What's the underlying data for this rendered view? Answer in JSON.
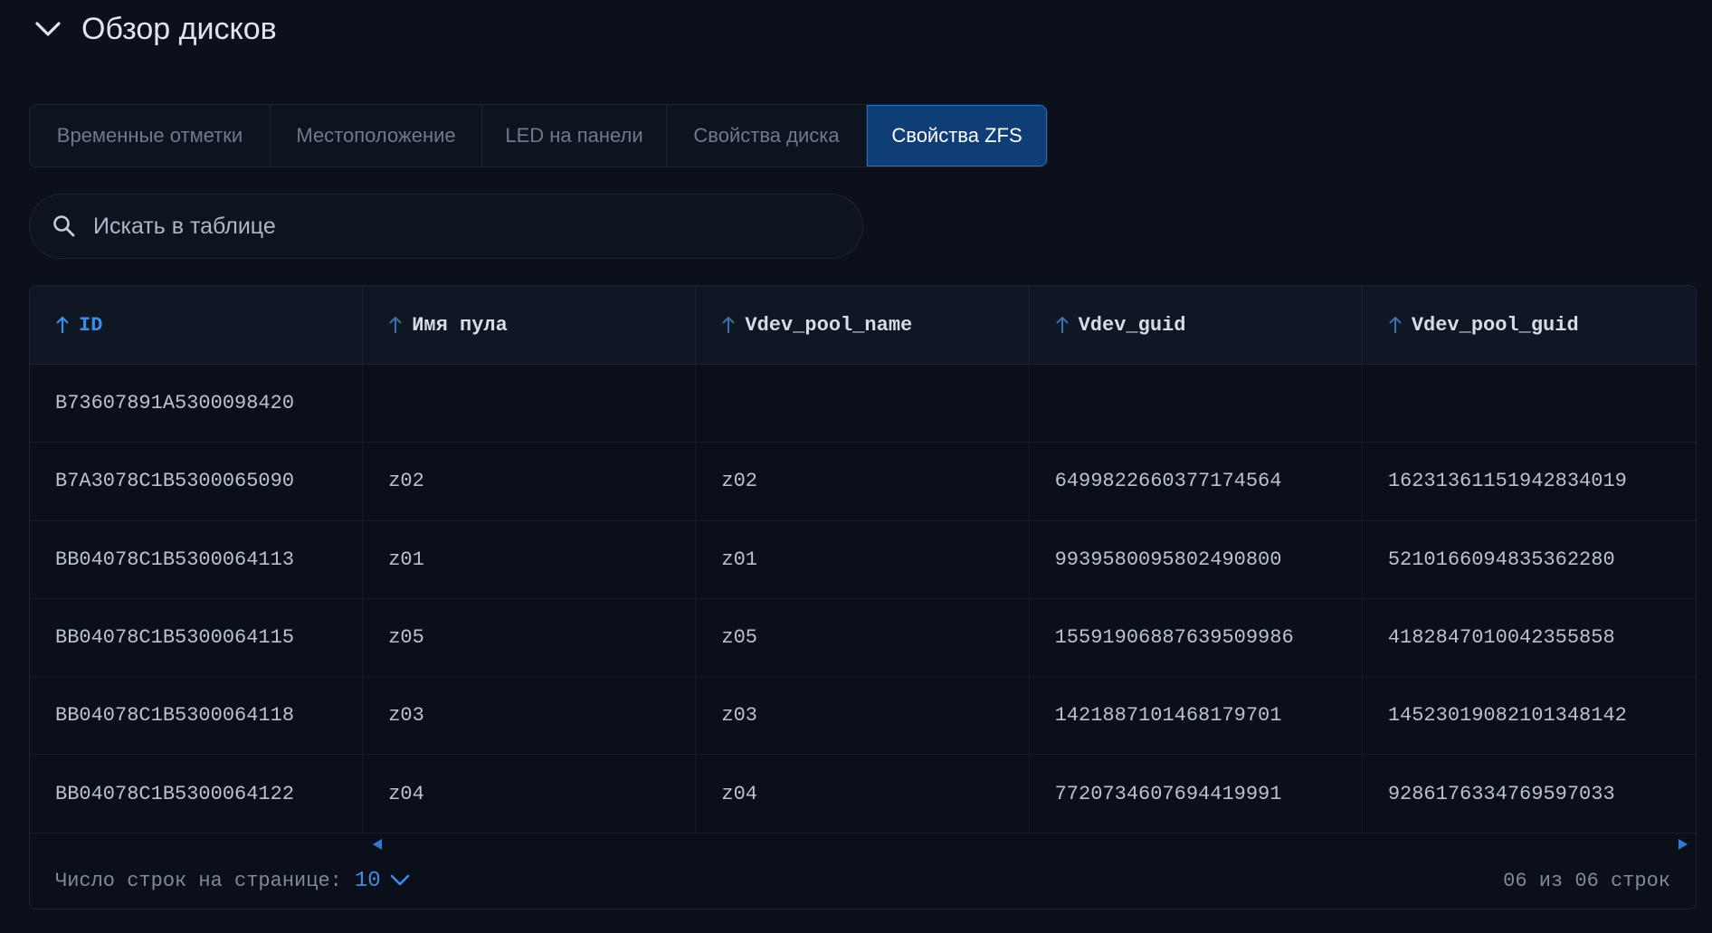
{
  "section": {
    "title": "Обзор дисков",
    "chevron_icon": "chevron-down-icon"
  },
  "tabs": [
    {
      "label": "Временные отметки",
      "active": false
    },
    {
      "label": "Местоположение",
      "active": false
    },
    {
      "label": "LED на панели",
      "active": false
    },
    {
      "label": "Свойства диска",
      "active": false
    },
    {
      "label": "Свойства ZFS",
      "active": true
    }
  ],
  "search": {
    "placeholder": "Искать в таблице",
    "icon": "search-icon"
  },
  "table": {
    "columns": [
      {
        "label": "ID",
        "sorted": true
      },
      {
        "label": "Имя пула",
        "sorted": false
      },
      {
        "label": "Vdev_pool_name",
        "sorted": false
      },
      {
        "label": "Vdev_guid",
        "sorted": false
      },
      {
        "label": "Vdev_pool_guid",
        "sorted": false
      }
    ],
    "rows": [
      [
        "B73607891A5300098420",
        "",
        "",
        "",
        ""
      ],
      [
        "B7A3078C1B5300065090",
        "z02",
        "z02",
        "6499822660377174564",
        "16231361151942834019"
      ],
      [
        "BB04078C1B5300064113",
        "z01",
        "z01",
        "9939580095802490800",
        "5210166094835362280"
      ],
      [
        "BB04078C1B5300064115",
        "z05",
        "z05",
        "15591906887639509986",
        "4182847010042355858"
      ],
      [
        "BB04078C1B5300064118",
        "z03",
        "z03",
        "1421887101468179701",
        "14523019082101348142"
      ],
      [
        "BB04078C1B5300064122",
        "z04",
        "z04",
        "7720734607694419991",
        "9286176334769597033"
      ]
    ]
  },
  "footer": {
    "rows_per_page_label": "Число строк на странице:",
    "rows_per_page_value": "10",
    "row_count_text": "06 из 06 строк"
  },
  "colors": {
    "background": "#0b101b",
    "accent": "#3d8ce8",
    "active_tab": "#0f3d75"
  }
}
